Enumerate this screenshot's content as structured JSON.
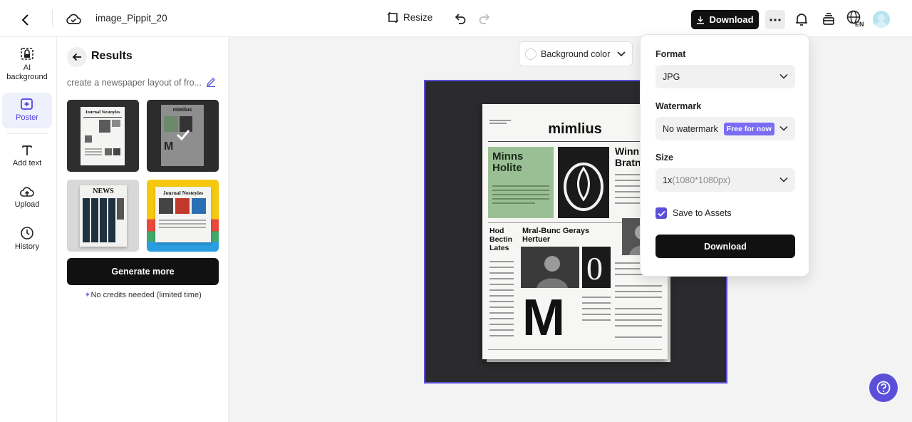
{
  "topbar": {
    "title": "image_Pippit_20",
    "resize_label": "Resize",
    "download_label": "Download",
    "lang_label": "EN"
  },
  "rail": {
    "items": [
      {
        "label": "AI background",
        "icon": "ai-background-icon"
      },
      {
        "label": "Poster",
        "icon": "poster-icon",
        "active": true
      },
      {
        "label": "Add text",
        "icon": "text-icon"
      },
      {
        "label": "Upload",
        "icon": "upload-icon"
      },
      {
        "label": "History",
        "icon": "history-icon"
      }
    ]
  },
  "results": {
    "title": "Results",
    "prompt": "create a newspaper layout of fro...",
    "thumb_titles": [
      "Journal Nestoyles",
      "mimlius",
      "NEWS",
      "Journal Nesteyies"
    ],
    "generate_label": "Generate more",
    "credits_note": "No credits needed (limited time)"
  },
  "canvas": {
    "bg_color_label": "Background color",
    "newspaper": {
      "masthead": "mimlius",
      "headline_green": "Minns Holite",
      "headline_right": "Winnic Bratn",
      "headline_left": "Hod Bectin Lates",
      "headline_mid": "Mral-Bunc Gerays Hertuer",
      "letter_big": "M",
      "letter_zero": "0"
    }
  },
  "download_panel": {
    "format_label": "Format",
    "format_value": "JPG",
    "watermark_label": "Watermark",
    "watermark_value": "No watermark",
    "watermark_badge": "Free for now",
    "size_label": "Size",
    "size_value": "1x",
    "size_dim": "(1080*1080px)",
    "save_label": "Save to Assets",
    "save_checked": true,
    "download_label": "Download"
  },
  "colors": {
    "accent": "#5b4fd9",
    "badge": "#7a6cf3",
    "dark": "#111111"
  }
}
